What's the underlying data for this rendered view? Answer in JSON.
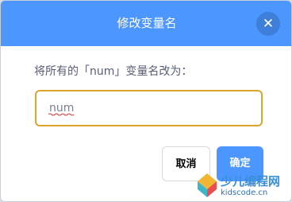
{
  "dialog": {
    "title": "修改变量名",
    "close_icon": "close-icon",
    "prompt": "将所有的「num」变量名改为：",
    "input_value": "num",
    "cancel_label": "取消",
    "ok_label": "确定"
  },
  "watermark": {
    "brand": "少儿编程网",
    "url": "kidscode.cn"
  },
  "colors": {
    "header": "#4c97ff",
    "close_button": "#3d7fd9",
    "input_border": "#d9a62e",
    "ok_button": "#4c97ff",
    "prompt_text": "#575e75"
  }
}
